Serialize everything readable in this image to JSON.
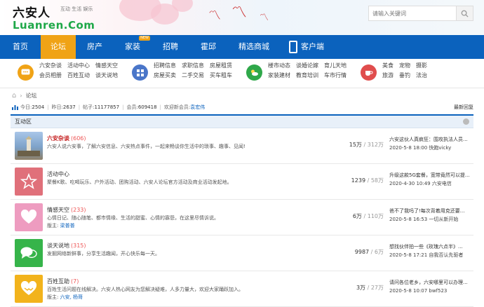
{
  "header": {
    "logo_cn": "六安人",
    "logo_en": "Luanren.Com",
    "slogan": "互动 生活 娱乐",
    "search_placeholder": "请输入关键词"
  },
  "nav": {
    "items": [
      "首页",
      "论坛",
      "房产",
      "家装",
      "招聘",
      "霍邱",
      "精选商城",
      "客户端"
    ],
    "new_badge": "NEW"
  },
  "categories": [
    {
      "icon": "chat-bubble-icon",
      "color": "#f0a316",
      "links": [
        "六安杂谈",
        "活动中心",
        "情感天空",
        "会员相册",
        "百姓互动",
        "谈天说地"
      ]
    },
    {
      "icon": "grid-icon",
      "color": "#4a76c9",
      "links": [
        "招聘信息",
        "求职信息",
        "房屋租赁",
        "房屋买卖",
        "二手交易",
        "买车租车"
      ]
    },
    {
      "icon": "weather-icon",
      "color": "#2fa84a",
      "links": [
        "楼市动态",
        "谈婚论嫁",
        "育儿天地",
        "家装建材",
        "教育培训",
        "车市行情"
      ]
    },
    {
      "icon": "coffee-cup-icon",
      "color": "#e04d4d",
      "links": [
        "美食",
        "宠物",
        "摄影",
        "旅游",
        "垂钓",
        "法治"
      ]
    }
  ],
  "breadcrumb": {
    "home": "⌂",
    "sep": "›",
    "current": "论坛"
  },
  "stats": {
    "today_label": "今日:",
    "today": "2504",
    "yesterday_label": "昨日:",
    "yesterday": "2637",
    "posts_label": "帖子:",
    "posts": "11177857",
    "members_label": "会员:",
    "members": "609418",
    "welcome_label": "欢迎新会员:",
    "new_member": "袁宏伟",
    "latest": "最新回复"
  },
  "section": {
    "title": "互动区"
  },
  "forums": [
    {
      "name": "六安杂谈",
      "count": "(606)",
      "desc": "六安人说六安事，了解六安信息、六安热点事件，一起来畅谈你生活中的琐事、趣事、见闻!",
      "mod_label": "",
      "mods": "",
      "threads": "15万",
      "posts": "/ 312万",
      "last_title": "六安这伙人真疯狂：围攻执法人员...",
      "last_meta": "2020-5-8 18:00 快跑vicky",
      "color": "#6c8fb5",
      "icon": "tower-icon"
    },
    {
      "name": "活动中心",
      "count": "",
      "desc": "聚餐K歌、吃喝玩乐、户外活动、团购活动、六安人论坛官方活动及商业活动发起地。",
      "mod_label": "",
      "mods": "",
      "threads": "1239",
      "posts": "/ 58万",
      "last_title": "升级这款5G套餐，宽带竟然可以提...",
      "last_meta": "2020-4-30 10:49 六安电信",
      "color": "#e0707a",
      "icon": "star-icon"
    },
    {
      "name": "情感天空",
      "count": "(233)",
      "desc": "心情日记、随心随笔、都市情缘、生活的甜蜜、心情的寡怨，在这里尽情诉说。",
      "mod_label": "版主:",
      "mods": "梁普普",
      "threads": "6万",
      "posts": "/ 110万",
      "last_title": "爸不了我吗了!每次背着用克还要...",
      "last_meta": "2020-5-8 16:53 一切从新开始",
      "color": "#ee9cc0",
      "icon": "heart-icon"
    },
    {
      "name": "谈天说地",
      "count": "(315)",
      "desc": "发掘网络新鲜事，分享生活趣闻，开心快乐每一天。",
      "mod_label": "",
      "mods": "",
      "threads": "9987",
      "posts": "/ 6万",
      "last_title": "想找伙伴拍一些《玫瑰六点半》...",
      "last_meta": "2020-5-8 17:21 自我否认先驱者",
      "color": "#36b44a",
      "icon": "speech-bubbles-icon"
    },
    {
      "name": "百姓互助",
      "count": "(7)",
      "desc": "百姓生活问题在线解决。六安人热心网友为您解决疑难，人多力量大，欢迎大家踊跃加入。",
      "mod_label": "版主:",
      "mods": "六安, 杨哥",
      "threads": "3万",
      "posts": "/ 27万",
      "last_title": "请问各位老乡，六安哪里可以办理...",
      "last_meta": "2020-5-8 10:07 bwf523",
      "color": "#f2b31c",
      "icon": "handshake-icon"
    }
  ]
}
